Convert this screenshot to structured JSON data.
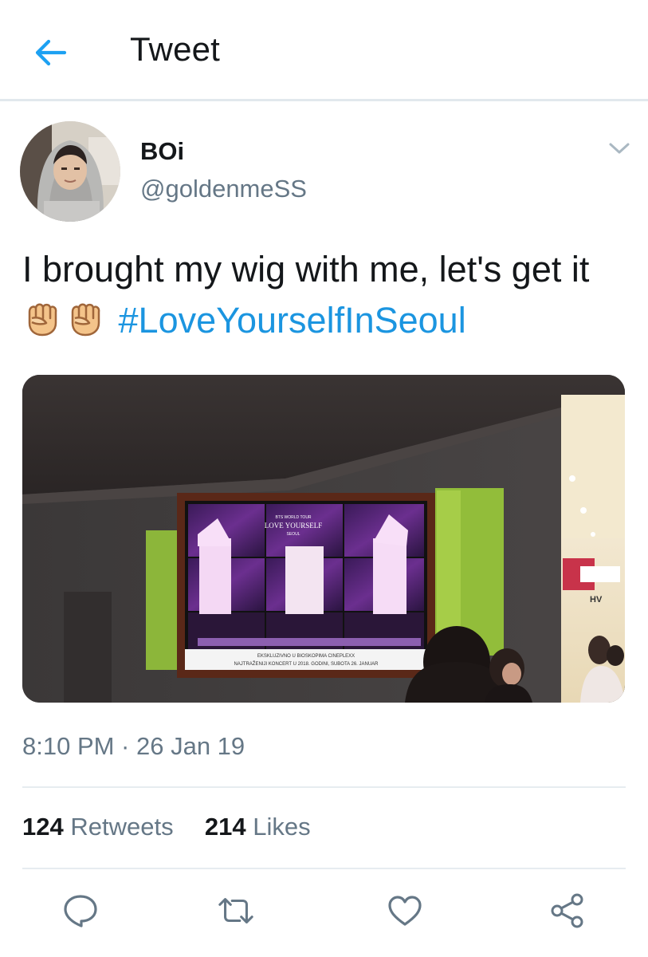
{
  "header": {
    "title": "Tweet",
    "back_icon": "arrow-left-icon",
    "accent_color": "#1da1f2"
  },
  "tweet": {
    "author": {
      "display_name": "BOi",
      "handle": "@goldenmeSS"
    },
    "text_main": "I brought my wig with me, let's get it",
    "emoji": "raised-fist-emoji",
    "hashtag": "#LoveYourselfInSeoul",
    "hashtag_color": "#1b95e0",
    "media": {
      "screen_line_1": "BTS WORLD TOUR",
      "screen_line_2": "LOVE YOURSELF",
      "screen_line_3": "SEOUL",
      "ticker_line_1": "EKSKLUZIVNO U BIOSKOPIMA CINEPLEXX",
      "ticker_line_2": "NAJTRAŽENIJI KONCERT U 2018. GODINI, SUBOTA 26. JANUAR",
      "store_sign": "HV"
    },
    "timestamp": "8:10 PM · 26 Jan 19",
    "stats": {
      "retweets_count": "124",
      "retweets_label": "Retweets",
      "likes_count": "214",
      "likes_label": "Likes"
    }
  },
  "actions": [
    "reply-icon",
    "retweet-icon",
    "like-icon",
    "share-icon"
  ]
}
